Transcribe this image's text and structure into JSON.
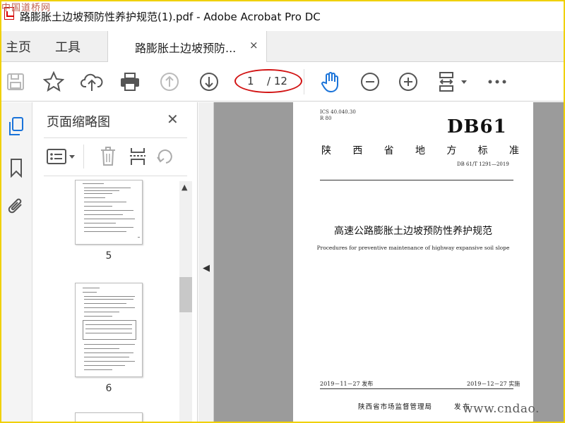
{
  "window": {
    "title": "路膨胀土边坡预防性养护规范(1).pdf - Adobe Acrobat Pro DC",
    "watermark_top": "中国道桥网"
  },
  "tabs": {
    "home": "主页",
    "tools": "工具",
    "document": "路膨胀土边坡预防...",
    "close": "×"
  },
  "toolbar": {
    "current_page": "1",
    "total_pages": "/ 12",
    "icons": [
      "save-icon",
      "star-icon",
      "upload-cloud-icon",
      "print-icon",
      "page-up-icon",
      "page-down-icon",
      "hand-tool-icon",
      "zoom-out-icon",
      "zoom-in-icon",
      "fit-page-icon",
      "more-icon"
    ]
  },
  "panel": {
    "title": "页面缩略图",
    "close": "✕",
    "thumbnails": [
      {
        "label": "5"
      },
      {
        "label": "6"
      }
    ]
  },
  "document": {
    "ics": "ICS 40.040.30",
    "r_code": "R 80",
    "db": "DB61",
    "province_chars": [
      "陕",
      "西",
      "省",
      "地",
      "方",
      "标",
      "准"
    ],
    "std_no": "DB 61/T 1291—2019",
    "title_zh": "高速公路膨胀土边坡预防性养护规范",
    "title_en": "Procedures for preventive maintenance of highway expansive soil slope",
    "publish": "2019－11－27 发布",
    "implement": "2019－12－27 实施",
    "issuer": "陕西省市场监督管理局",
    "issue": "发布"
  },
  "watermark_bottom": "www.cndao."
}
